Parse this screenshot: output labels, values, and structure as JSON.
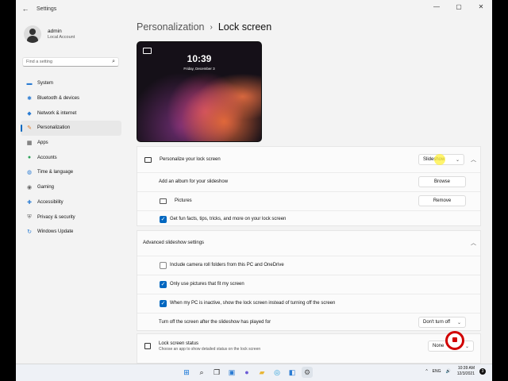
{
  "window": {
    "title": "Settings",
    "back": "←",
    "controls": [
      "—",
      "▢",
      "✕"
    ]
  },
  "user": {
    "name": "admin",
    "account": "Local Account"
  },
  "search": {
    "placeholder": "Find a setting"
  },
  "nav": [
    {
      "label": "System",
      "icon": "monitor-icon",
      "glyph": "▬",
      "color": "#2b7cd3"
    },
    {
      "label": "Bluetooth & devices",
      "icon": "bluetooth-icon",
      "glyph": "✱",
      "color": "#2b7cd3"
    },
    {
      "label": "Network & internet",
      "icon": "wifi-icon",
      "glyph": "◆",
      "color": "#2b7cd3"
    },
    {
      "label": "Personalization",
      "icon": "brush-icon",
      "glyph": "✎",
      "color": "#e07b2a",
      "active": true
    },
    {
      "label": "Apps",
      "icon": "apps-icon",
      "glyph": "▦",
      "color": "#444"
    },
    {
      "label": "Accounts",
      "icon": "person-icon",
      "glyph": "●",
      "color": "#2fa35a"
    },
    {
      "label": "Time & language",
      "icon": "globe-icon",
      "glyph": "◍",
      "color": "#2b7cd3"
    },
    {
      "label": "Gaming",
      "icon": "gamepad-icon",
      "glyph": "◉",
      "color": "#666"
    },
    {
      "label": "Accessibility",
      "icon": "accessibility-icon",
      "glyph": "✚",
      "color": "#2b7cd3"
    },
    {
      "label": "Privacy & security",
      "icon": "shield-icon",
      "glyph": "⛨",
      "color": "#666"
    },
    {
      "label": "Windows Update",
      "icon": "update-icon",
      "glyph": "↻",
      "color": "#2b7cd3"
    }
  ],
  "breadcrumb": {
    "parent": "Personalization",
    "separator": "›",
    "current": "Lock screen"
  },
  "preview": {
    "time": "10:39",
    "date": "Friday, December 3"
  },
  "personalize": {
    "label": "Personalize your lock screen",
    "value": "Slideshow",
    "add_album_label": "Add an album for your slideshow",
    "browse": "Browse",
    "folder": "Pictures",
    "remove": "Remove",
    "fun_facts": "Get fun facts, tips, tricks, and more on your lock screen",
    "fun_facts_checked": true
  },
  "advanced": {
    "label": "Advanced slideshow settings",
    "options": [
      {
        "label": "Include camera roll folders from this PC and OneDrive",
        "checked": false
      },
      {
        "label": "Only use pictures that fit my screen",
        "checked": true
      },
      {
        "label": "When my PC is inactive, show the lock screen instead of turning off the screen",
        "checked": true
      }
    ],
    "turn_off_label": "Turn off the screen after the slideshow has played for",
    "turn_off_value": "Don't turn off"
  },
  "status": {
    "label": "Lock screen status",
    "sub": "Choose an app to show detailed status on the lock screen",
    "value": "None"
  },
  "taskbar": {
    "tray_lang": "ENG",
    "time": "10:39 AM",
    "date": "12/3/2021",
    "notif_count": "3",
    "tray_icons": "^",
    "volume": "🔊"
  },
  "colors": {
    "accent": "#0067c0",
    "record": "#d10000"
  }
}
